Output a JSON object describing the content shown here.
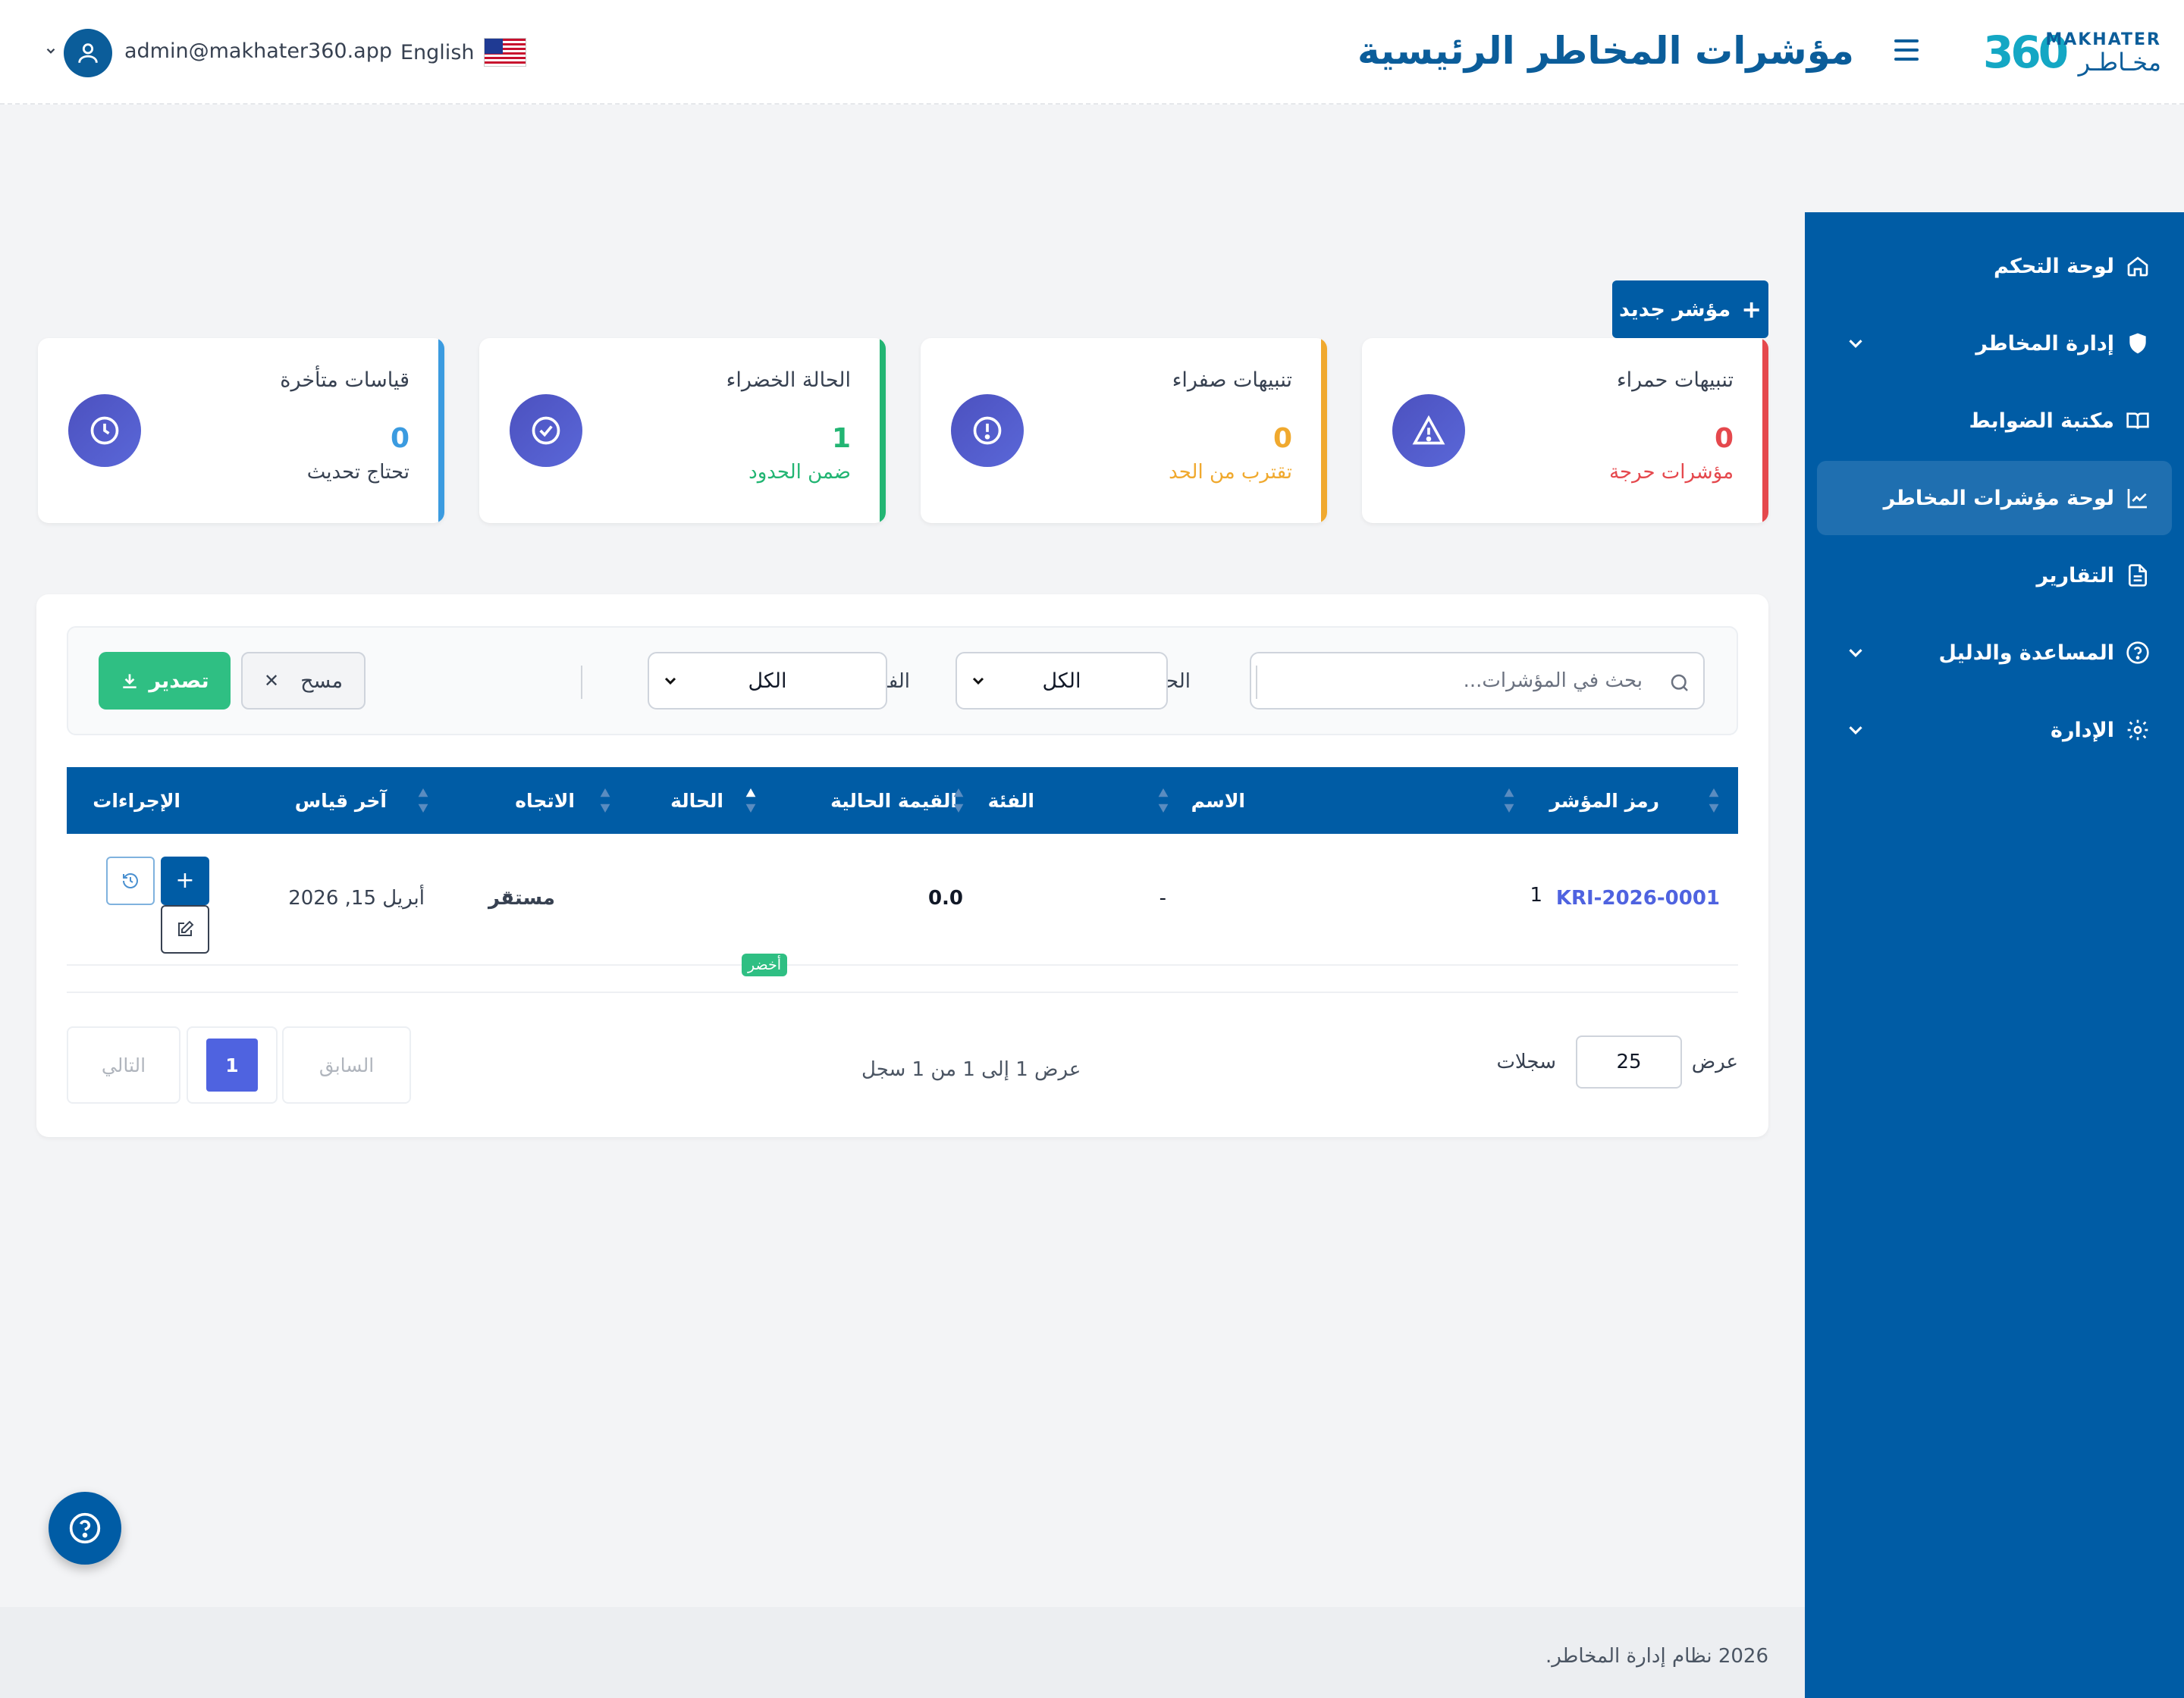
{
  "header": {
    "logo_number": "360",
    "logo_en": "MAKHATER",
    "logo_ar": "مخـاطـر",
    "title": "مؤشرات المخاطر الرئيسية",
    "language": "English",
    "user_email": "admin@makhater360.app"
  },
  "sidebar": {
    "items": [
      {
        "label": "لوحة التحكم",
        "icon": "home-icon"
      },
      {
        "label": "إدارة المخاطر",
        "icon": "shield-icon",
        "has_children": true
      },
      {
        "label": "مكتبة الضوابط",
        "icon": "book-icon"
      },
      {
        "label": "لوحة مؤشرات المخاطر",
        "icon": "chart-line-icon",
        "active": true
      },
      {
        "label": "التقارير",
        "icon": "document-icon"
      },
      {
        "label": "المساعدة والدليل",
        "icon": "help-circle-icon",
        "has_children": true
      },
      {
        "label": "الإدارة",
        "icon": "gear-icon",
        "has_children": true
      }
    ]
  },
  "new_button": "مؤشر جديد",
  "cards": [
    {
      "title": "تنبيهات حمراء",
      "value": "0",
      "subtitle": "مؤشرات حرجة",
      "color": "#e5484d",
      "icon": "warning-triangle-icon"
    },
    {
      "title": "تنبيهات صفراء",
      "value": "0",
      "subtitle": "تقترب من الحد",
      "color": "#f0a92e",
      "icon": "exclamation-circle-icon"
    },
    {
      "title": "الحالة الخضراء",
      "value": "1",
      "subtitle": "ضمن الحدود",
      "color": "#22b573",
      "icon": "check-circle-icon"
    },
    {
      "title": "قياسات متأخرة",
      "value": "0",
      "subtitle": "تحتاج تحديث",
      "color": "#3b9be0",
      "icon": "clock-icon"
    }
  ],
  "filters": {
    "search_placeholder": "بحث في المؤشرات...",
    "status_label": "الحالة:",
    "status_value": "الكل",
    "category_label": "الفئة:",
    "category_value": "الكل",
    "clear_label": "مسح",
    "export_label": "تصدير"
  },
  "table": {
    "columns": [
      "رمز المؤشر",
      "الاسم",
      "الفئة",
      "القيمة الحالية",
      "الحالة",
      "الاتجاه",
      "آخر قياس",
      "الإجراءات"
    ],
    "rows": [
      {
        "code": "KRI-2026-0001",
        "name_num": "1",
        "category": "-",
        "value": "0.0",
        "status": "أخضر",
        "trend": "مستقر",
        "last": "أبريل 15, 2026"
      }
    ]
  },
  "pagination": {
    "show_label": "عرض",
    "page_size": "25",
    "records_label": "سجلات",
    "info": "عرض 1 إلى 1 من 1 سجل",
    "prev": "السابق",
    "current": "1",
    "next": "التالي"
  },
  "footer": "2026 نظام إدارة المخاطر.",
  "colors": {
    "primary": "#005ca5",
    "accent": "#4f63e0",
    "success": "#2fbf83"
  }
}
